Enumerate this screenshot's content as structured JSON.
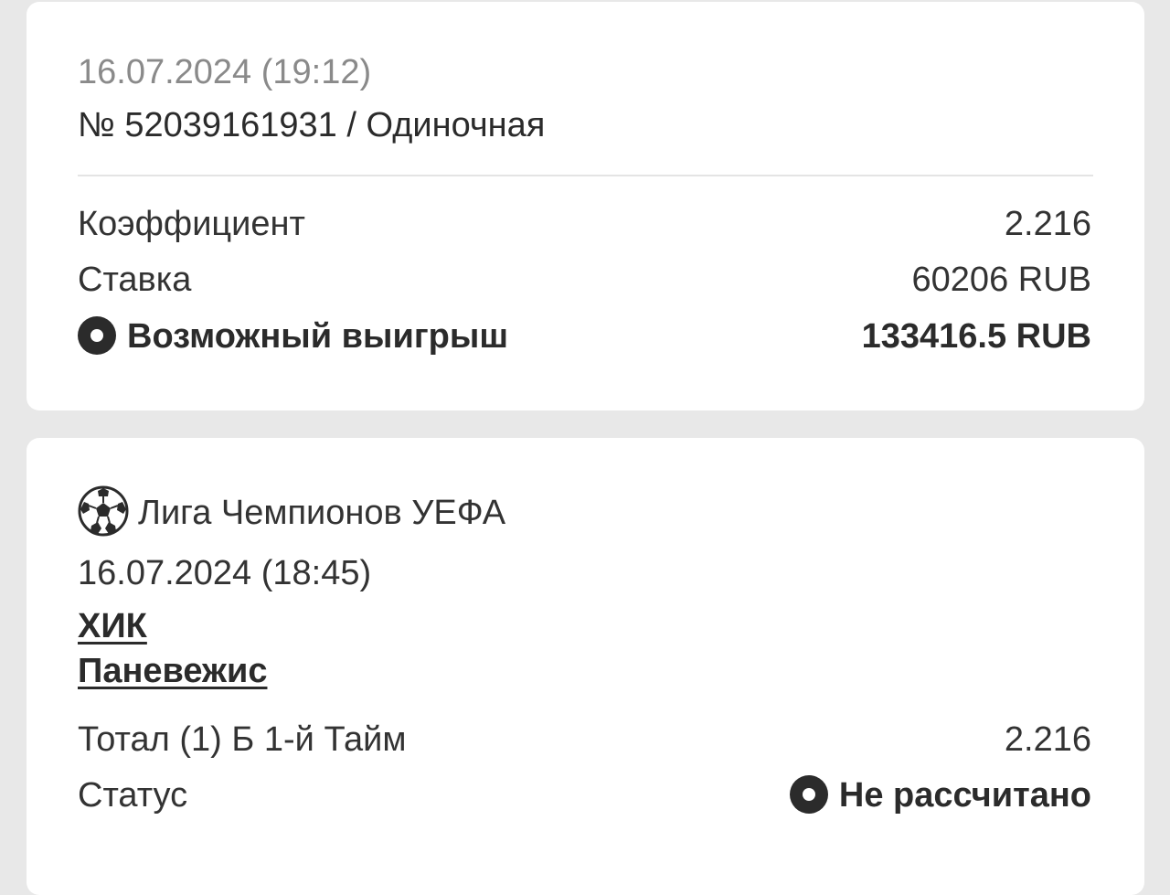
{
  "bet_summary": {
    "datetime": "16.07.2024 (19:12)",
    "bet_id": "№ 52039161931 / Одиночная",
    "coefficient_label": "Коэффициент",
    "coefficient_value": "2.216",
    "stake_label": "Ставка",
    "stake_value": "60206 RUB",
    "possible_win_label": "Возможный выигрыш",
    "possible_win_value": "133416.5 RUB",
    "possible_win_icon": "radio-dot-icon"
  },
  "event": {
    "sport_icon": "soccer-ball-icon",
    "league": "Лига Чемпионов УЕФА",
    "datetime": "16.07.2024 (18:45)",
    "team_home": "ХИК",
    "team_away": "Паневежис",
    "market_label": "Тотал (1) Б 1-й Тайм",
    "market_value": "2.216",
    "status_label": "Статус",
    "status_value": "Не рассчитано",
    "status_icon": "radio-dot-icon"
  },
  "colors": {
    "background": "#e8e8e8",
    "card": "#ffffff",
    "text_primary": "#2b2b2b",
    "text_secondary": "#8a8a8a"
  }
}
